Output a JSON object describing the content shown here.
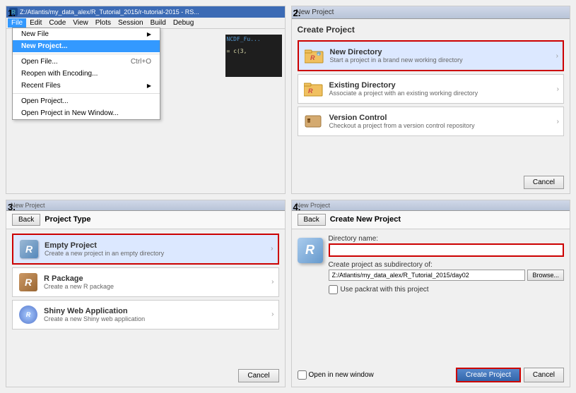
{
  "steps": {
    "s1": {
      "num": "1.",
      "title_bar": "Z:/Atlantis/my_data_alex/R_Tutorial_2015/r-tutorial-2015 - RS...",
      "menu_items": [
        "File",
        "Edit",
        "Code",
        "View",
        "Plots",
        "Session",
        "Build",
        "Debug"
      ],
      "active_menu": "File",
      "dropdown": {
        "items": [
          {
            "label": "New File",
            "shortcut": "",
            "arrow": true,
            "type": "item"
          },
          {
            "label": "New Project...",
            "shortcut": "",
            "arrow": false,
            "type": "selected"
          },
          {
            "label": "sep1",
            "type": "separator"
          },
          {
            "label": "Open File...",
            "shortcut": "Ctrl+O",
            "arrow": false,
            "type": "item"
          },
          {
            "label": "Reopen with Encoding...",
            "shortcut": "",
            "arrow": false,
            "type": "item"
          },
          {
            "label": "Recent Files",
            "shortcut": "",
            "arrow": true,
            "type": "item"
          },
          {
            "label": "sep2",
            "type": "separator"
          },
          {
            "label": "Open Project...",
            "shortcut": "",
            "arrow": false,
            "type": "item"
          },
          {
            "label": "Open Project in New Window...",
            "shortcut": "",
            "arrow": false,
            "type": "item"
          }
        ]
      },
      "code_snippet": "= c(3,"
    },
    "s2": {
      "num": "2.",
      "dialog_title": "New Project",
      "header": "Create Project",
      "options": [
        {
          "title": "New Directory",
          "desc": "Start a project in a brand new working directory",
          "highlighted": true,
          "icon": "folder_new"
        },
        {
          "title": "Existing Directory",
          "desc": "Associate a project with an existing working directory",
          "highlighted": false,
          "icon": "folder_existing"
        },
        {
          "title": "Version Control",
          "desc": "Checkout a project from a version control repository",
          "highlighted": false,
          "icon": "folder_vcs"
        }
      ],
      "cancel_label": "Cancel"
    },
    "s3": {
      "num": "3.",
      "dialog_title": "New Project",
      "back_label": "Back",
      "header": "Project Type",
      "options": [
        {
          "title": "Empty Project",
          "desc": "Create a new project in an empty directory",
          "highlighted": true,
          "icon": "r_blue"
        },
        {
          "title": "R Package",
          "desc": "Create a new R package",
          "highlighted": false,
          "icon": "r_package"
        },
        {
          "title": "Shiny Web Application",
          "desc": "Create a new Shiny web application",
          "highlighted": false,
          "icon": "r_shiny"
        }
      ],
      "cancel_label": "Cancel"
    },
    "s4": {
      "num": "4.",
      "dialog_title": "New Project",
      "back_label": "Back",
      "header": "Create New Project",
      "dir_name_label": "Directory name:",
      "dir_name_value": "",
      "subdir_label": "Create project as subdirectory of:",
      "subdir_value": "Z:/Atlantis/my_data_alex/R_Tutorial_2015/day02",
      "browse_label": "Browse...",
      "packrat_label": "Use packrat with this project",
      "open_new_window_label": "Open in new window",
      "create_label": "Create Project",
      "cancel_label": "Cancel"
    }
  }
}
